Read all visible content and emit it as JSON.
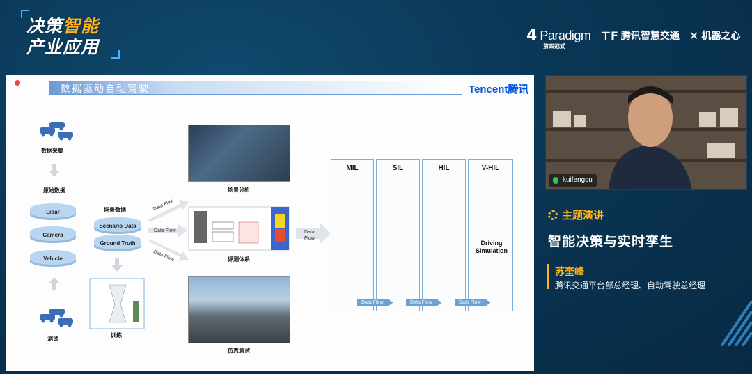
{
  "event": {
    "line1a": "决策",
    "line1b": "智能",
    "line2": "产业应用"
  },
  "sponsors": {
    "paradigm": {
      "mark": "4",
      "name": "Paradigm",
      "sub": "第四范式"
    },
    "tencent": {
      "mark": "⊤F",
      "name": "腾讯智慧交通"
    },
    "jqzx": {
      "mark": "✕",
      "name": "机器之心"
    }
  },
  "slide": {
    "title": "数据驱动自动驾驶",
    "brand": "Tencent腾讯",
    "left": {
      "collect": "数据采集",
      "raw": "原始数据",
      "lidar": "Lidar",
      "camera": "Camera",
      "vehicle": "Vehicle",
      "test": "测试"
    },
    "middle": {
      "scene_data": "场景数据",
      "scenario": "Scenario Data",
      "ground_truth": "Ground Truth",
      "train": "训练"
    },
    "flows": {
      "df1": "Data Flow",
      "df2": "Data Flow",
      "df3": "Data Flow",
      "df4": "Data Flow"
    },
    "panels": {
      "scene_analysis": "场景分析",
      "eval_system": "评测体系",
      "sim_test": "仿真测试"
    },
    "stages": {
      "mil": "MIL",
      "sil": "SIL",
      "hil": "HIL",
      "vhil": "V-HIL",
      "driving_sim": "Driving Simulation"
    },
    "bottom_flows": {
      "f1": "Data Flow",
      "f2": "Data Flow",
      "f3": "Data Flow"
    }
  },
  "camera": {
    "username": "kuifengsu"
  },
  "talk": {
    "label": "主题演讲",
    "title": "智能决策与实时孪生",
    "speaker": "苏奎峰",
    "role": "腾讯交通平台部总经理、自动驾驶总经理"
  },
  "colors": {
    "accent": "#ffb21b",
    "background": "#0a3655",
    "slide_blue": "#6aa2d6"
  }
}
